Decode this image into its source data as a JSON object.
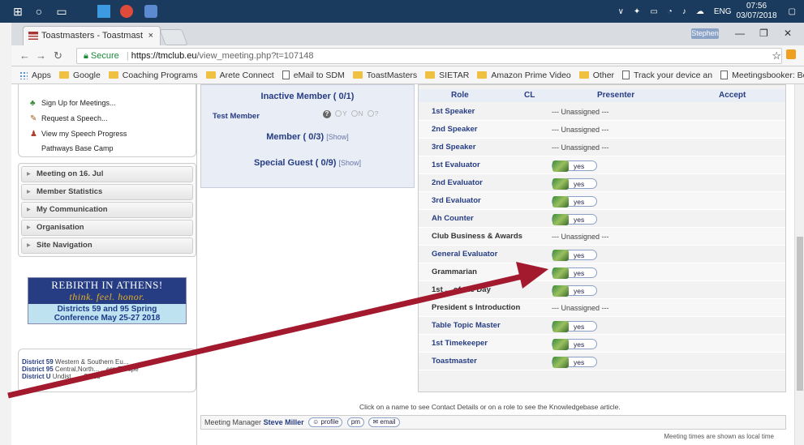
{
  "taskbar": {
    "tray_lang": "ENG",
    "clock_time": "07:56",
    "clock_date": "03/07/2018"
  },
  "browser": {
    "tab_title": "Toastmasters - Toastmast",
    "tab_close": "×",
    "profile_name": "Stephen",
    "url_secure": "Secure",
    "url_host": "https://tmclub.eu",
    "url_path": "/view_meeting.php?t=107148",
    "bookmarks": [
      {
        "label": "Apps",
        "type": "apps"
      },
      {
        "label": "Google",
        "type": "folder"
      },
      {
        "label": "Coaching Programs",
        "type": "folder"
      },
      {
        "label": "Arete Connect",
        "type": "folder"
      },
      {
        "label": "eMail to SDM",
        "type": "page"
      },
      {
        "label": "ToastMasters",
        "type": "folder"
      },
      {
        "label": "SIETAR",
        "type": "folder"
      },
      {
        "label": "Amazon Prime Video",
        "type": "folder"
      },
      {
        "label": "Other",
        "type": "folder"
      },
      {
        "label": "Track your device an",
        "type": "page"
      },
      {
        "label": "Meetingsbooker: Bo",
        "type": "page"
      }
    ]
  },
  "sidebar": {
    "links": [
      {
        "label": "Sign Up for Meetings...",
        "icon": "plant-icon"
      },
      {
        "label": "Request a Speech...",
        "icon": "pin-icon"
      },
      {
        "label": "View my Speech Progress",
        "icon": "person-icon"
      },
      {
        "label": "Pathways Base Camp",
        "icon": ""
      }
    ],
    "sections": [
      "Meeting on 16. Jul",
      "Member Statistics",
      "My Communication",
      "Organisation",
      "Site Navigation"
    ],
    "banner": {
      "line1": "REBIRTH IN ATHENS!",
      "line2": "think. feel. honor.",
      "line3": "Districts 59 and 95 Spring",
      "line4": "Conference May 25-27 2018"
    },
    "districts": [
      {
        "code": "District 59",
        "text": "Western & Southern Eu..."
      },
      {
        "code": "District 95",
        "text": "Central,North... ...ern Europe"
      },
      {
        "code": "District U",
        "text": "Undist... ...Clubs"
      }
    ]
  },
  "attendance": {
    "inactive_title": "Inactive Member ( 0/1)",
    "test_member": "Test Member",
    "radio_y": "Y",
    "radio_n": "N",
    "radio_q": "?",
    "member_title": "Member ( 0/3)",
    "guest_title": "Special Guest ( 0/9)",
    "show": "[Show]"
  },
  "roles_table": {
    "headers": {
      "role": "Role",
      "cl": "CL",
      "presenter": "Presenter",
      "accept": "Accept"
    },
    "rows": [
      {
        "role": "1st Speaker",
        "presenter": "--- Unassigned ---",
        "yes": false
      },
      {
        "role": "2nd Speaker",
        "presenter": "--- Unassigned ---",
        "yes": false
      },
      {
        "role": "3rd Speaker",
        "presenter": "--- Unassigned ---",
        "yes": false
      },
      {
        "role": "1st Evaluator",
        "presenter": "yes",
        "yes": true
      },
      {
        "role": "2nd Evaluator",
        "presenter": "yes",
        "yes": true
      },
      {
        "role": "3rd Evaluator",
        "presenter": "yes",
        "yes": true
      },
      {
        "role": "Ah Counter",
        "presenter": "yes",
        "yes": true
      },
      {
        "role": "Club Business & Awards",
        "presenter": "--- Unassigned ---",
        "yes": false
      },
      {
        "role": "General Evaluator",
        "presenter": "yes",
        "yes": true
      },
      {
        "role": "Grammarian",
        "presenter": "yes",
        "yes": true
      },
      {
        "role": "1st ... of the Day",
        "presenter": "yes",
        "yes": true
      },
      {
        "role": "President s Introduction",
        "presenter": "--- Unassigned ---",
        "yes": false
      },
      {
        "role": "Table Topic Master",
        "presenter": "yes",
        "yes": true
      },
      {
        "role": "1st Timekeeper",
        "presenter": "yes",
        "yes": true
      },
      {
        "role": "Toastmaster",
        "presenter": "yes",
        "yes": true
      }
    ]
  },
  "footer": {
    "hint": "Click on a name to see Contact Details or on a role to see the Knowledgebase article.",
    "manager_label": "Meeting Manager",
    "manager_name": "Steve Miller",
    "profile": "profile",
    "pm": "pm",
    "email": "email",
    "local_time_note": "Meeting times are shown as local time"
  },
  "colors": {
    "accent": "#263d84",
    "arrow": "#a3192e"
  }
}
